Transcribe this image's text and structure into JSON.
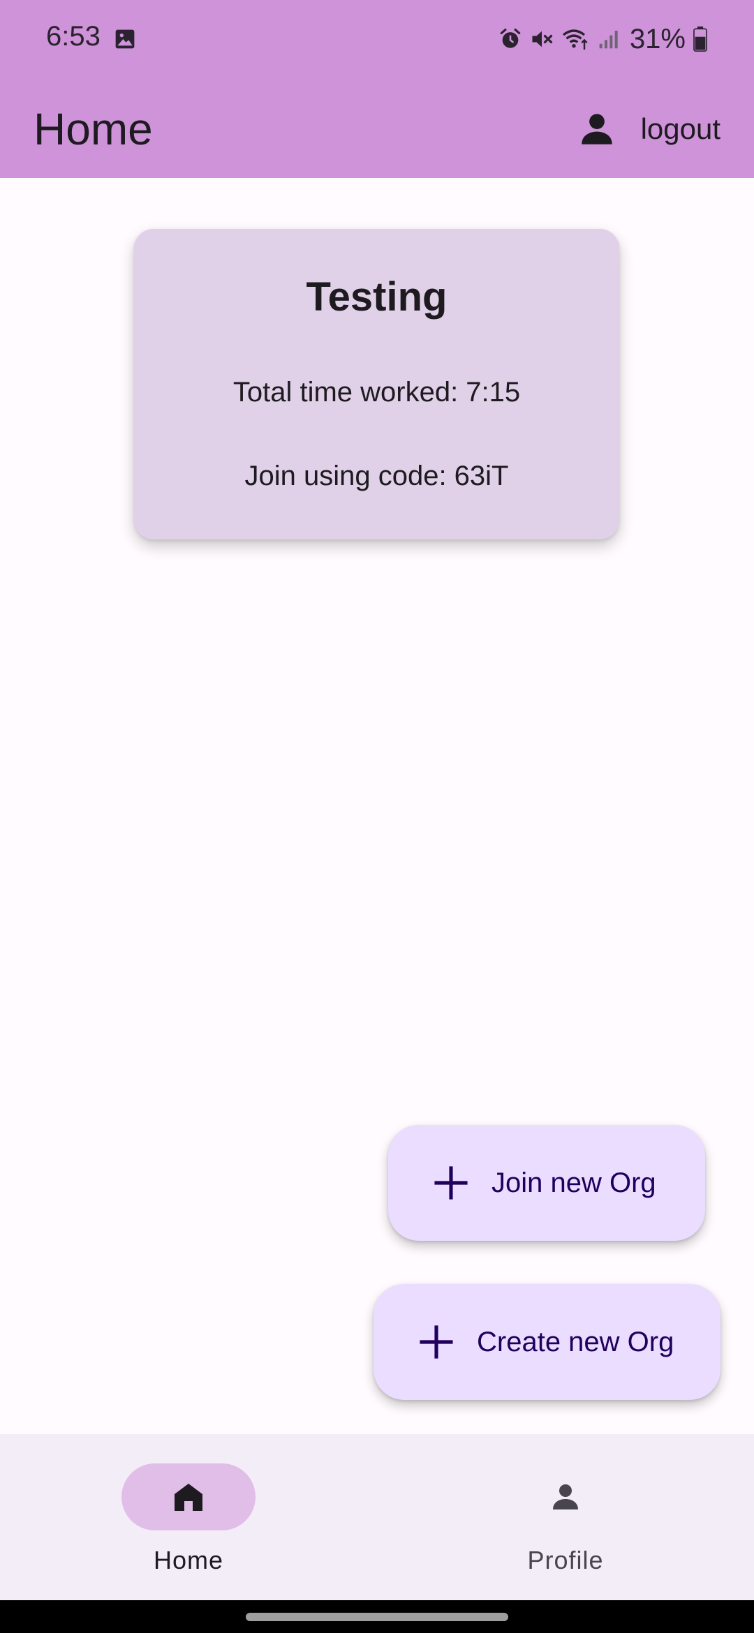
{
  "status_bar": {
    "time": "6:53",
    "battery": "31%",
    "icons": [
      "image-icon",
      "alarm-icon",
      "mute-icon",
      "wifi-icon",
      "signal-icon",
      "battery-icon"
    ]
  },
  "app_bar": {
    "title": "Home",
    "logout_label": "logout",
    "logout_icon": "person-icon"
  },
  "card": {
    "title": "Testing",
    "total_time": "Total time worked: 7:15",
    "join_code": "Join using code: 63iT"
  },
  "fabs": {
    "join_label": "Join new Org",
    "create_label": "Create new Org",
    "icon": "plus-icon"
  },
  "bottom_nav": {
    "items": [
      {
        "label": "Home",
        "icon": "home-icon",
        "selected": true
      },
      {
        "label": "Profile",
        "icon": "person-icon",
        "selected": false
      }
    ]
  },
  "colors": {
    "app_bar": "#CE93D8",
    "card": "#E0D0E8",
    "fab": "#EADDFF",
    "fab_text": "#21005D",
    "nav_background": "#F3EDF7",
    "nav_indicator": "#E1BEE7"
  }
}
